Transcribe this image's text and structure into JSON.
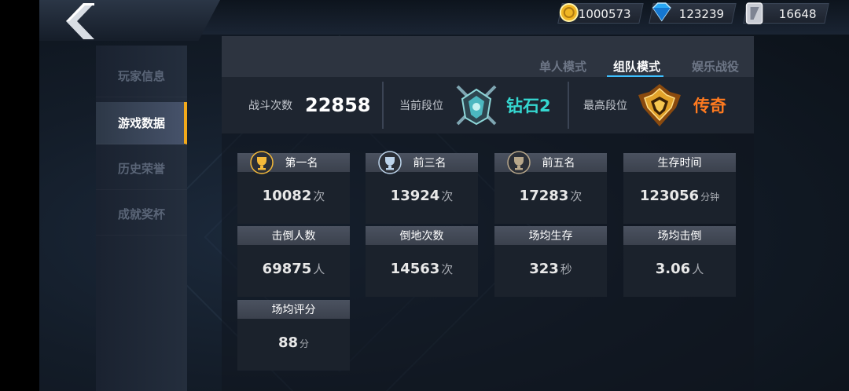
{
  "currency": [
    {
      "icon": "gold-coin-icon",
      "value": "1000573"
    },
    {
      "icon": "diamond-icon",
      "value": "123239"
    },
    {
      "icon": "ticket-icon",
      "value": "16648"
    }
  ],
  "sidebar": {
    "items": [
      {
        "label": "玩家信息"
      },
      {
        "label": "游戏数据"
      },
      {
        "label": "历史荣誉"
      },
      {
        "label": "成就奖杯"
      }
    ],
    "active_index": 1
  },
  "tabs": [
    {
      "label": "单人模式"
    },
    {
      "label": "组队模式"
    },
    {
      "label": "娱乐战役"
    }
  ],
  "ranks": {
    "battles_label": "战斗次数",
    "battles_value": "22858",
    "current_label": "当前段位",
    "current_value": "钻石2",
    "highest_label": "最高段位",
    "highest_value": "传奇"
  },
  "stats": [
    {
      "label": "第一名",
      "value": "10082",
      "unit": "次",
      "trophy": "gold"
    },
    {
      "label": "前三名",
      "value": "13924",
      "unit": "次",
      "trophy": "silver"
    },
    {
      "label": "前五名",
      "value": "17283",
      "unit": "次",
      "trophy": "bronze"
    },
    {
      "label": "生存时间",
      "value": "123056",
      "unit": "分钟"
    },
    {
      "label": "击倒人数",
      "value": "69875",
      "unit": "人"
    },
    {
      "label": "倒地次数",
      "value": "14563",
      "unit": "次"
    },
    {
      "label": "场均生存",
      "value": "323",
      "unit": "秒"
    },
    {
      "label": "场均击倒",
      "value": "3.06",
      "unit": "人"
    },
    {
      "label": "场均评分",
      "value": "88",
      "unit": "分"
    }
  ],
  "colors": {
    "accent_blue": "#3ec0ff",
    "active_marker": "#f2a91b",
    "diamond_rank_text": "#35d7d0",
    "legend_rank_text": "#ff7a1f"
  }
}
